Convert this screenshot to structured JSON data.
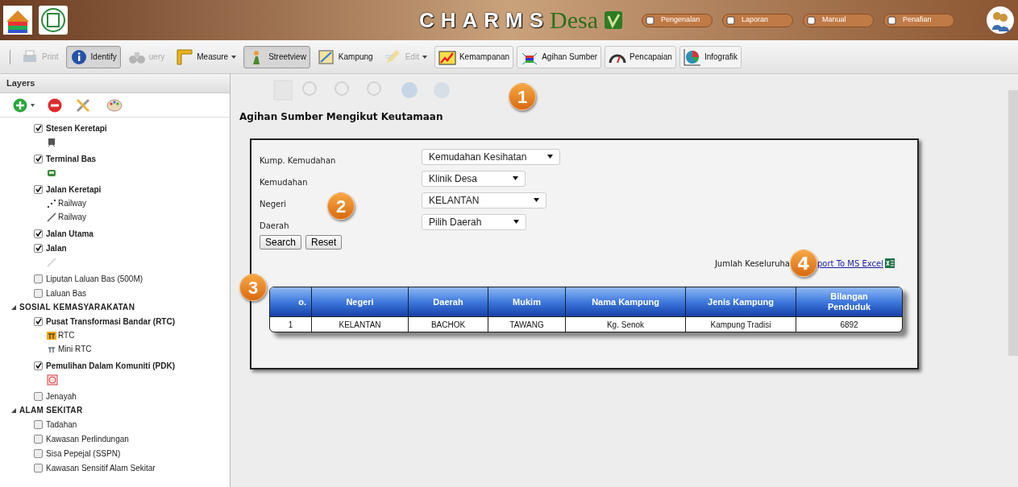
{
  "banner": {
    "title": "CHARMS",
    "brand": "Desa",
    "links": [
      {
        "label": "Pengenalan"
      },
      {
        "label": "Laporan"
      },
      {
        "label": "Manual"
      },
      {
        "label": "Penafian"
      }
    ]
  },
  "toolbar": [
    {
      "label": "Print",
      "kind": "printer",
      "selected": false,
      "disabled": true,
      "dropdown": false,
      "framed": false
    },
    {
      "label": "Identify",
      "kind": "info",
      "selected": true,
      "disabled": false,
      "dropdown": false,
      "framed": true
    },
    {
      "label": "uery",
      "kind": "binoculars",
      "selected": false,
      "disabled": true,
      "dropdown": false,
      "framed": false
    },
    {
      "label": "Measure",
      "kind": "ruler",
      "selected": false,
      "disabled": false,
      "dropdown": true,
      "framed": false
    },
    {
      "label": "Streetview",
      "kind": "person",
      "selected": true,
      "disabled": false,
      "dropdown": false,
      "framed": true
    },
    {
      "label": "Kampung",
      "kind": "map",
      "selected": false,
      "disabled": false,
      "dropdown": false,
      "framed": false
    },
    {
      "label": "Edit",
      "kind": "pencil",
      "selected": false,
      "disabled": true,
      "dropdown": true,
      "framed": false
    },
    {
      "label": "Kemampanan",
      "kind": "chart",
      "selected": false,
      "disabled": false,
      "dropdown": false,
      "framed": true
    },
    {
      "label": "Agihan Sumber",
      "kind": "network",
      "selected": false,
      "disabled": false,
      "dropdown": false,
      "framed": true
    },
    {
      "label": "Pencapaian",
      "kind": "gauge",
      "selected": false,
      "disabled": false,
      "dropdown": false,
      "framed": true
    },
    {
      "label": "Infografik",
      "kind": "pie",
      "selected": false,
      "disabled": false,
      "dropdown": false,
      "framed": true
    }
  ],
  "layers": {
    "title": "Layers",
    "items": [
      {
        "kind": "layer",
        "label": "Stesen Keretapi",
        "checked": true,
        "legend": [
          {
            "kind": "train"
          }
        ]
      },
      {
        "kind": "layer",
        "label": "Terminal Bas",
        "checked": true,
        "legend": [
          {
            "kind": "bus"
          }
        ]
      },
      {
        "kind": "layer",
        "label": "Jalan Keretapi",
        "checked": true,
        "legend": [
          {
            "kind": "dots",
            "label": "Railway"
          },
          {
            "kind": "line",
            "label": "Railway"
          }
        ]
      },
      {
        "kind": "layer",
        "label": "Jalan Utama",
        "checked": true
      },
      {
        "kind": "layer",
        "label": "Jalan",
        "checked": true,
        "legend": [
          {
            "kind": "faint"
          }
        ]
      },
      {
        "kind": "layer",
        "label": "Liputan Laluan Bas (500M)",
        "checked": false
      },
      {
        "kind": "layer",
        "label": "Laluan Bas",
        "checked": false
      },
      {
        "kind": "group",
        "label": "SOSIAL KEMASYARAKATAN",
        "expanded": true,
        "children": [
          {
            "kind": "layer",
            "label": "Pusat Transformasi Bandar (RTC)",
            "checked": true,
            "legend": [
              {
                "kind": "rtc",
                "label": "RTC"
              },
              {
                "kind": "minirtc",
                "label": "Mini RTC"
              }
            ]
          },
          {
            "kind": "layer",
            "label": "Pemulihan Dalam Komuniti (PDK)",
            "checked": true,
            "legend": [
              {
                "kind": "pdk"
              }
            ]
          },
          {
            "kind": "layer",
            "label": "Jenayah",
            "checked": false
          }
        ]
      },
      {
        "kind": "group",
        "label": "ALAM SEKITAR",
        "expanded": true,
        "children": [
          {
            "kind": "layer",
            "label": "Tadahan",
            "checked": false
          },
          {
            "kind": "layer",
            "label": "Kawasan Perlindungan",
            "checked": false
          },
          {
            "kind": "layer",
            "label": "Sisa Pepejal (SSPN)",
            "checked": false
          },
          {
            "kind": "layer",
            "label": "Kawasan Sensitif Alam Sekitar",
            "checked": false
          }
        ]
      }
    ]
  },
  "panel": {
    "title": "Agihan Sumber Mengikut Keutamaan",
    "fields": [
      {
        "label": "Kump. Kemudahan",
        "value": "Kemudahan Kesihatan"
      },
      {
        "label": "Kemudahan",
        "value": "Klinik Desa"
      },
      {
        "label": "Negeri",
        "value": "KELANTAN"
      },
      {
        "label": "Daerah",
        "value": "Pilih Daerah"
      }
    ],
    "buttons": [
      "Search",
      "Reset"
    ],
    "total_label": "Jumlah Keseluruha",
    "export_link": "port To MS Excel",
    "table": {
      "columns": [
        "o.",
        "Negeri",
        "Daerah",
        "Mukim",
        "Nama Kampung",
        "Jenis Kampung",
        "Bilangan Penduduk"
      ],
      "rows": [
        [
          "1",
          "KELANTAN",
          "BACHOK",
          "TAWANG",
          "Kg. Senok",
          "Kampung Tradisi",
          "6892"
        ]
      ]
    }
  },
  "callouts": [
    "1",
    "2",
    "3",
    "4"
  ]
}
